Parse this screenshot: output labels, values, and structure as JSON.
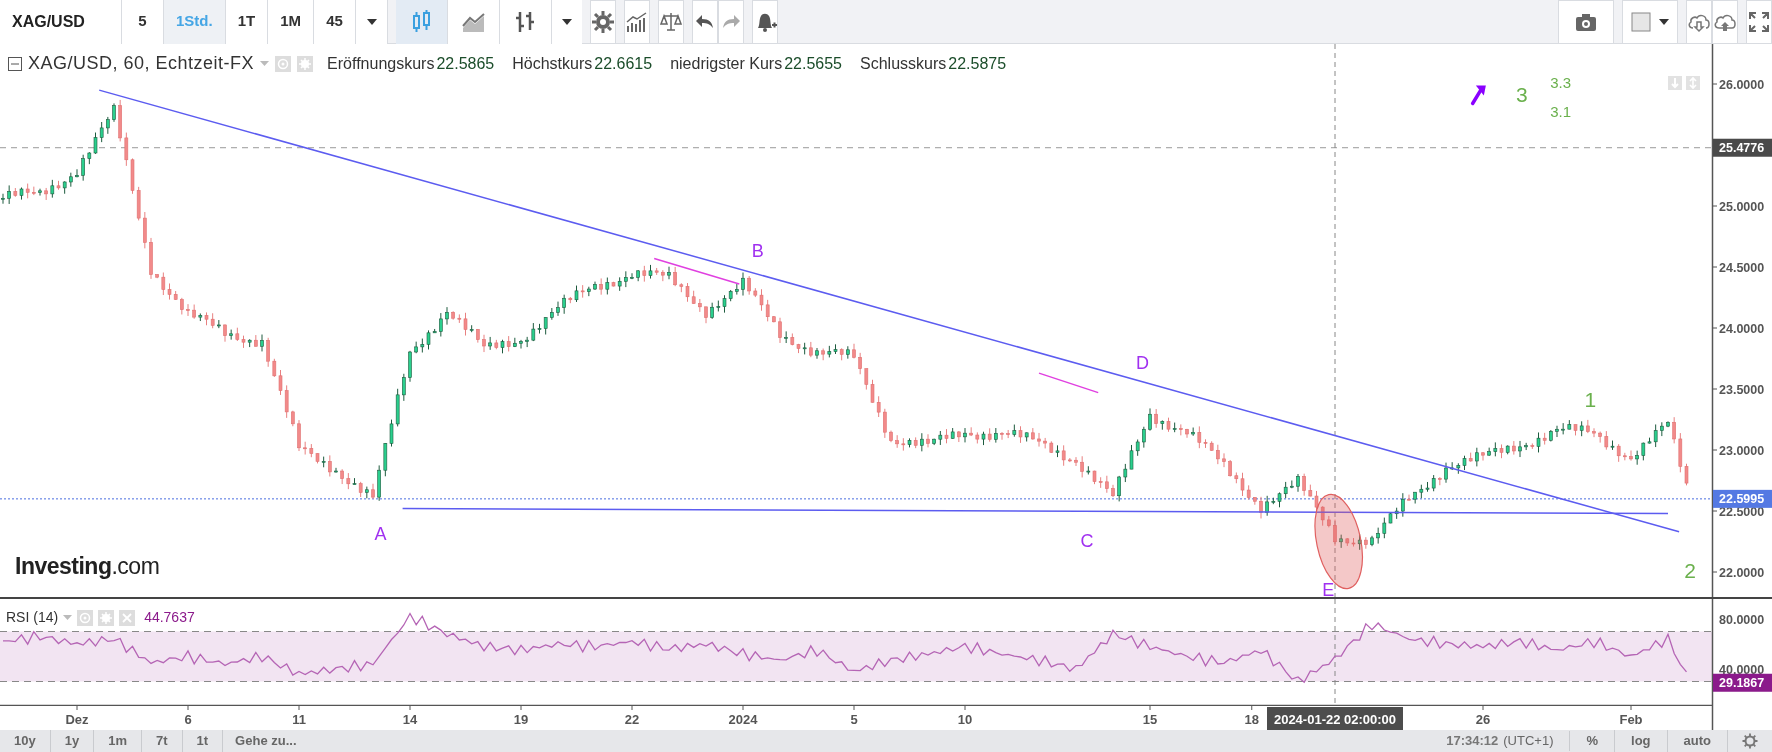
{
  "toolbar": {
    "symbol": "XAG/USD",
    "intervals": [
      {
        "label": "5",
        "selected": false
      },
      {
        "label": "1Std.",
        "selected": true
      },
      {
        "label": "1T",
        "selected": false
      },
      {
        "label": "1M",
        "selected": false
      },
      {
        "label": "45",
        "selected": false
      }
    ],
    "chart_styles": [
      {
        "kind": "candles",
        "selected": true
      },
      {
        "kind": "line",
        "selected": false
      },
      {
        "kind": "bars",
        "selected": false
      }
    ]
  },
  "legend": {
    "title": "XAG/USD, 60, Echtzeit-FX",
    "fields": [
      {
        "label": "Eröffnungskurs",
        "value": "22.5865"
      },
      {
        "label": "Höchstkurs",
        "value": "22.6615"
      },
      {
        "label": "niedrigster Kurs",
        "value": "22.5655"
      },
      {
        "label": "Schlusskurs",
        "value": "22.5875"
      }
    ]
  },
  "price_chart": {
    "branding": "**Investing**.com",
    "marker_label": "25.4776",
    "last_price_label": "22.5995",
    "crosshair_label": "2024-01-22 02:00:00",
    "price_axis": [
      "26.0000",
      "25.0000",
      "24.5000",
      "24.0000",
      "23.5000",
      "23.0000",
      "22.5000",
      "22.0000"
    ],
    "time_axis": [
      "Dez",
      "6",
      "11",
      "14",
      "19",
      "22",
      "2024",
      "5",
      "10",
      "15",
      "18",
      "26",
      "Feb"
    ],
    "drawing_labels": [
      {
        "text": "B",
        "color": "#a030f0"
      },
      {
        "text": "D",
        "color": "#a030f0"
      },
      {
        "text": "A",
        "color": "#a030f0"
      },
      {
        "text": "C",
        "color": "#a030f0"
      },
      {
        "text": "E",
        "color": "#a030f0"
      },
      {
        "text": "3",
        "color": "#6ab04c"
      },
      {
        "text": "3.3",
        "color": "#6ab04c"
      },
      {
        "text": "3.1",
        "color": "#6ab04c"
      },
      {
        "text": "1",
        "color": "#6ab04c"
      },
      {
        "text": "2",
        "color": "#6ab04c"
      }
    ]
  },
  "rsi": {
    "title": "RSI (14)",
    "value": "44.7637",
    "reading_label": "29.1867",
    "axis": [
      "80.0000",
      "40.0000"
    ]
  },
  "bottom_bar": {
    "ranges": [
      "10y",
      "1y",
      "1m",
      "7t",
      "1t"
    ],
    "goto": "Gehe zu...",
    "time": "17:34:12",
    "timezone": "(UTC+1)",
    "options": [
      "%",
      "log",
      "auto"
    ]
  }
}
